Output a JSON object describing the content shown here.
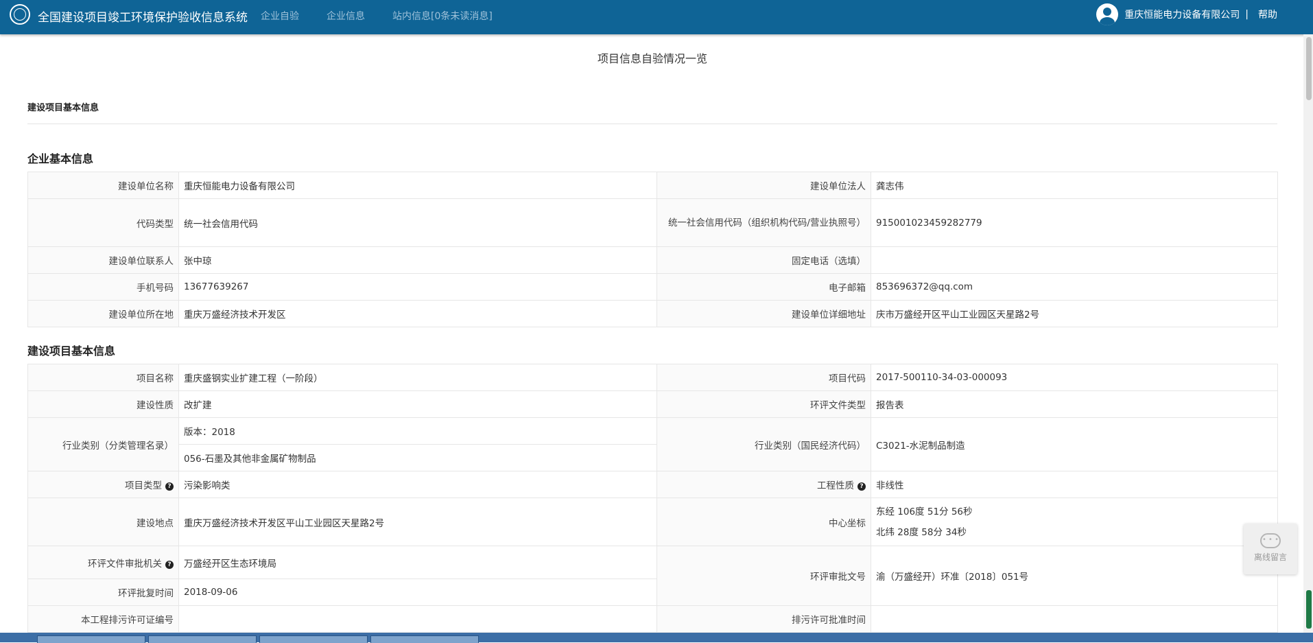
{
  "header": {
    "title": "全国建设项目竣工环境保护验收信息系统",
    "nav": [
      "企业自验",
      "企业信息",
      "站内信息[0条未读消息]"
    ],
    "user_name": "重庆恒能电力设备有限公司",
    "separator": "|",
    "help_label": "帮助",
    "bar_color": "#0f6496"
  },
  "page_title": "项目信息自验情况一览",
  "section_small": "建设项目基本信息",
  "enterprise": {
    "title": "企业基本信息",
    "rows": [
      {
        "l1": "建设单位名称",
        "v1": "重庆恒能电力设备有限公司",
        "l2": "建设单位法人",
        "v2": "龚志伟"
      },
      {
        "l1": "代码类型",
        "v1": "统一社会信用代码",
        "l2": "统一社会信用代码（组织机构代码/营业执照号）",
        "v2": "915001023459282779"
      },
      {
        "l1": "建设单位联系人",
        "v1": "张中琼",
        "l2": "固定电话（选填）",
        "v2": ""
      },
      {
        "l1": "手机号码",
        "v1": "13677639267",
        "l2": "电子邮箱",
        "v2": "853696372@qq.com"
      },
      {
        "l1": "建设单位所在地",
        "v1": "重庆万盛经济技术开发区",
        "l2": "建设单位详细地址",
        "v2": "庆市万盛经开区平山工业园区天星路2号"
      }
    ]
  },
  "project": {
    "title": "建设项目基本信息",
    "name_label": "项目名称",
    "name": "重庆盛钢实业扩建工程（一阶段）",
    "code_label": "项目代码",
    "code": "2017-500110-34-03-000093",
    "nature_label": "建设性质",
    "nature": "改扩建",
    "eia_type_label": "环评文件类型",
    "eia_type": "报告表",
    "industry_label": "行业类别（分类管理名录）",
    "industry_version": "版本：2018",
    "industry_value": "056-石墨及其他非金属矿物制品",
    "econ_label": "行业类别（国民经济代码）",
    "econ_value": "C3021-水泥制品制造",
    "ptype_label": "项目类型",
    "ptype": "污染影响类",
    "eng_label": "工程性质",
    "eng": "非线性",
    "site_label": "建设地点",
    "site": "重庆万盛经济技术开发区平山工业园区天星路2号",
    "coord_label": "中心坐标",
    "lng": "东经 106度 51分 56秒",
    "lat": "北纬 28度 58分 34秒",
    "approver_label": "环评文件审批机关",
    "approver": "万盛经开区生态环境局",
    "approval_no_label": "环评审批文号",
    "approval_no": "渝（万盛经开）环准〔2018〕051号",
    "approval_time_label": "环评批复时间",
    "approval_time": "2018-09-06",
    "permit_label": "本工程排污许可证编号",
    "permit": "",
    "permit_time_label": "排污许可批准时间",
    "permit_time": ""
  },
  "help_glyph": "?",
  "float_label": "离线留言"
}
